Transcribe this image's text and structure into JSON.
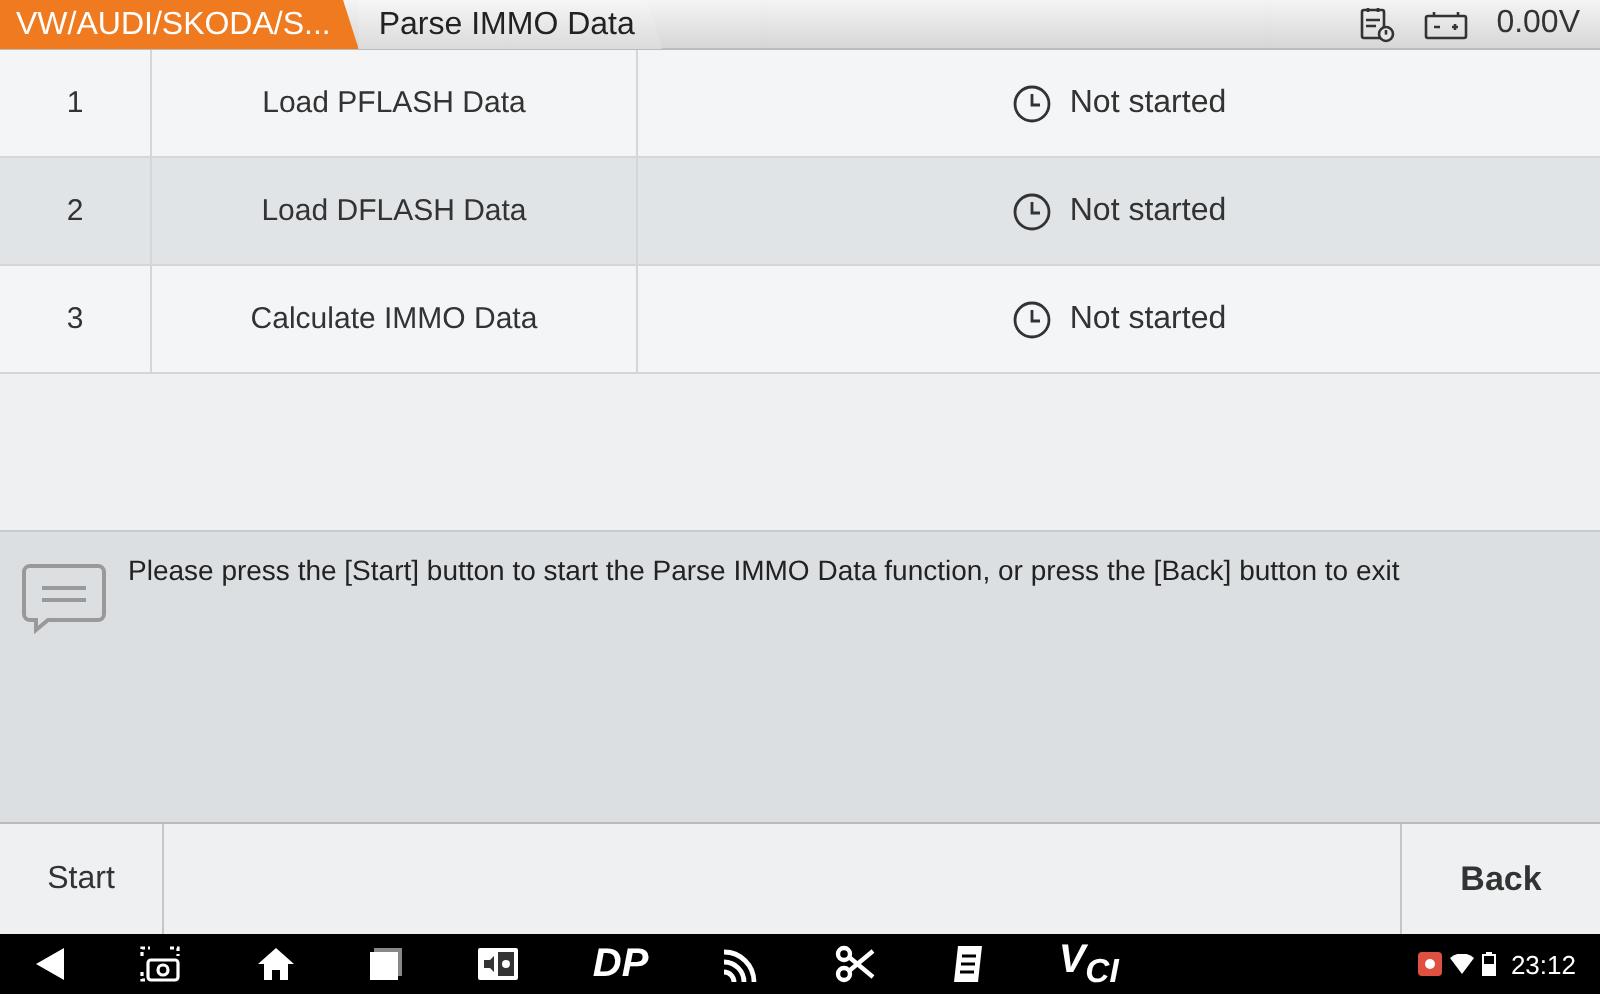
{
  "breadcrumbs": [
    {
      "label": "VW/AUDI/SKODA/S...",
      "selected": false
    },
    {
      "label": "Parse IMMO Data",
      "selected": true
    }
  ],
  "status": {
    "voltage": "0.00V"
  },
  "steps": [
    {
      "number": "1",
      "name": "Load PFLASH Data",
      "status": "Not started",
      "selected": false
    },
    {
      "number": "2",
      "name": "Load DFLASH Data",
      "status": "Not started",
      "selected": true
    },
    {
      "number": "3",
      "name": "Calculate IMMO Data",
      "status": "Not started",
      "selected": false
    }
  ],
  "message": "Please press the [Start] button to start the Parse IMMO Data function, or press the [Back] button to exit",
  "buttons": [
    {
      "label": "Start",
      "kind": "left"
    },
    {
      "label": "Back",
      "kind": "right"
    }
  ],
  "taskbar": [
    {
      "kind": "back"
    },
    {
      "kind": "screenshot"
    },
    {
      "kind": "home"
    },
    {
      "kind": "recents"
    },
    {
      "kind": "card"
    },
    {
      "kind": "text",
      "label": "DP"
    },
    {
      "kind": "wifi"
    },
    {
      "kind": "tools"
    },
    {
      "kind": "notes"
    },
    {
      "kind": "text",
      "label": "V$_{CI}$"
    }
  ],
  "clock": "23:12"
}
